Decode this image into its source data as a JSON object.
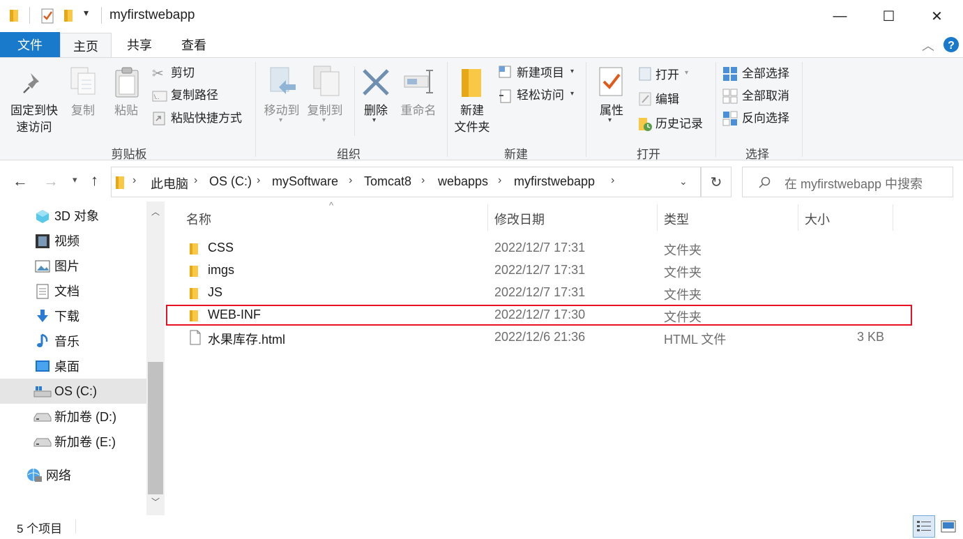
{
  "window": {
    "title": "myfirstwebapp",
    "minimize": "—",
    "maximize": "☐",
    "close": "✕"
  },
  "tabs": [
    {
      "label": "文件"
    },
    {
      "label": "主页"
    },
    {
      "label": "共享"
    },
    {
      "label": "查看"
    }
  ],
  "ribbon": {
    "clipboard": {
      "group": "剪贴板",
      "pin_line1": "固定到快",
      "pin_line2": "速访问",
      "copy": "复制",
      "paste": "粘贴",
      "cut": "剪切",
      "copy_path": "复制路径",
      "paste_shortcut": "粘贴快捷方式"
    },
    "organize": {
      "group": "组织",
      "move_to": "移动到",
      "copy_to": "复制到",
      "delete": "删除",
      "rename": "重命名"
    },
    "new": {
      "group": "新建",
      "new_folder_line1": "新建",
      "new_folder_line2": "文件夹",
      "new_item": "新建项目",
      "easy_access": "轻松访问"
    },
    "open": {
      "group": "打开",
      "properties": "属性",
      "open": "打开",
      "edit": "编辑",
      "history": "历史记录"
    },
    "select": {
      "group": "选择",
      "select_all": "全部选择",
      "select_none": "全部取消",
      "invert": "反向选择"
    }
  },
  "address": {
    "crumbs": [
      "此电脑",
      "OS (C:)",
      "mySoftware",
      "Tomcat8",
      "webapps",
      "myfirstwebapp"
    ],
    "search_placeholder": "在 myfirstwebapp 中搜索"
  },
  "nav": [
    {
      "label": "3D 对象",
      "icon": "3d-objects-icon"
    },
    {
      "label": "视频",
      "icon": "video-icon"
    },
    {
      "label": "图片",
      "icon": "pictures-icon"
    },
    {
      "label": "文档",
      "icon": "documents-icon"
    },
    {
      "label": "下载",
      "icon": "download-icon"
    },
    {
      "label": "音乐",
      "icon": "music-icon"
    },
    {
      "label": "桌面",
      "icon": "desktop-icon"
    },
    {
      "label": "OS (C:)",
      "icon": "drive-c-icon",
      "selected": true
    },
    {
      "label": "新加卷 (D:)",
      "icon": "drive-icon"
    },
    {
      "label": "新加卷 (E:)",
      "icon": "drive-icon"
    },
    {
      "label": "网络",
      "icon": "network-icon"
    }
  ],
  "columns": {
    "name": "名称",
    "date": "修改日期",
    "type": "类型",
    "size": "大小"
  },
  "files": [
    {
      "name": "CSS",
      "date": "2022/12/7 17:31",
      "type": "文件夹",
      "size": "",
      "kind": "folder"
    },
    {
      "name": "imgs",
      "date": "2022/12/7 17:31",
      "type": "文件夹",
      "size": "",
      "kind": "folder"
    },
    {
      "name": "JS",
      "date": "2022/12/7 17:31",
      "type": "文件夹",
      "size": "",
      "kind": "folder"
    },
    {
      "name": "WEB-INF",
      "date": "2022/12/7 17:30",
      "type": "文件夹",
      "size": "",
      "kind": "folder"
    },
    {
      "name": "水果库存.html",
      "date": "2022/12/6 21:36",
      "type": "HTML 文件",
      "size": "3 KB",
      "kind": "file"
    }
  ],
  "status": {
    "count": "5 个项目"
  },
  "colors": {
    "accent": "#1979ca",
    "highlight": "#e81123",
    "folder": "#f8c846"
  }
}
